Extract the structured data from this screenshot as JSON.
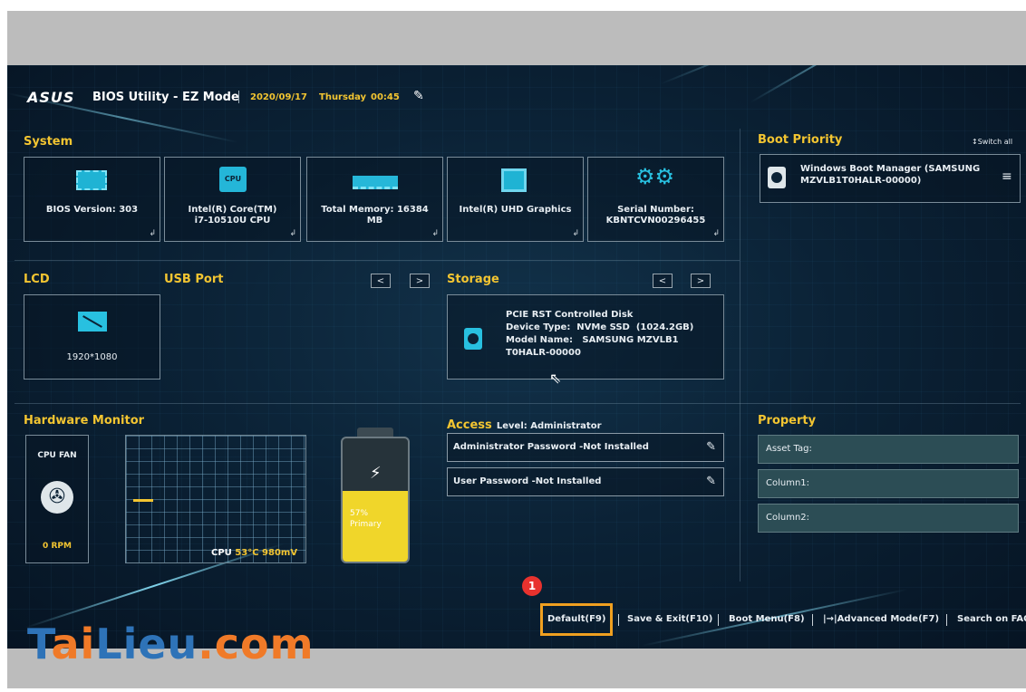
{
  "header": {
    "logo": "ASUS",
    "title": "BIOS Utility - EZ Mode",
    "date": "2020/09/17",
    "day": "Thursday",
    "time": "00:45"
  },
  "system": {
    "heading": "System",
    "cards": [
      {
        "icon": "chip-icon",
        "line1": "BIOS Version: 303",
        "line2": ""
      },
      {
        "icon": "cpu-icon",
        "line1": "Intel(R) Core(TM)",
        "line2": "i7-10510U CPU"
      },
      {
        "icon": "memory-icon",
        "line1": "Total Memory: 16384",
        "line2": "MB"
      },
      {
        "icon": "graphics-icon",
        "line1": "Intel(R) UHD Graphics",
        "line2": ""
      },
      {
        "icon": "gears-icon",
        "line1": "Serial Number:",
        "line2": "KBNTCVN00296455"
      }
    ]
  },
  "boot_priority": {
    "heading": "Boot Priority",
    "switch_all": "Switch all",
    "item_line1": "Windows Boot Manager (SAMSUNG",
    "item_line2": "MZVLB1T0HALR-00000)"
  },
  "lcd": {
    "heading": "LCD",
    "resolution": "1920*1080"
  },
  "usb": {
    "heading": "USB Port",
    "prev": "<",
    "next": ">"
  },
  "storage": {
    "heading": "Storage",
    "prev": "<",
    "next": ">",
    "line1": "PCIE RST Controlled Disk",
    "line2": "Device Type:  NVMe SSD  (1024.2GB)",
    "line3": "Model Name:   SAMSUNG MZVLB1",
    "line4": "T0HALR-00000"
  },
  "hardware_monitor": {
    "heading": "Hardware Monitor",
    "fan_label": "CPU FAN",
    "fan_rpm": "0 RPM",
    "cpu_label": "CPU",
    "cpu_temp": "53°C",
    "cpu_volt": "980mV",
    "battery_percent": "57%",
    "battery_label": "Primary",
    "battery_level": 0.57
  },
  "access": {
    "heading": "Access",
    "level": "Level: Administrator",
    "admin_password": "Administrator Password -Not Installed",
    "user_password": "User Password -Not Installed"
  },
  "property": {
    "heading": "Property",
    "asset_tag": "Asset Tag:",
    "column1": "Column1:",
    "column2": "Column2:"
  },
  "bottom": {
    "badge": "1",
    "default": "Default(F9)",
    "save_exit": "Save & Exit(F10)",
    "boot_menu": "Boot Menu(F8)",
    "advanced": "|→|Advanced Mode(F7)",
    "search": "Search on FAQ"
  },
  "watermark": "TaiLieu.com",
  "colors": {
    "accent_yellow": "#f3c531",
    "highlight_orange": "#f0a020",
    "badge_red": "#e8322e",
    "panel_bg": "#0b2236"
  }
}
